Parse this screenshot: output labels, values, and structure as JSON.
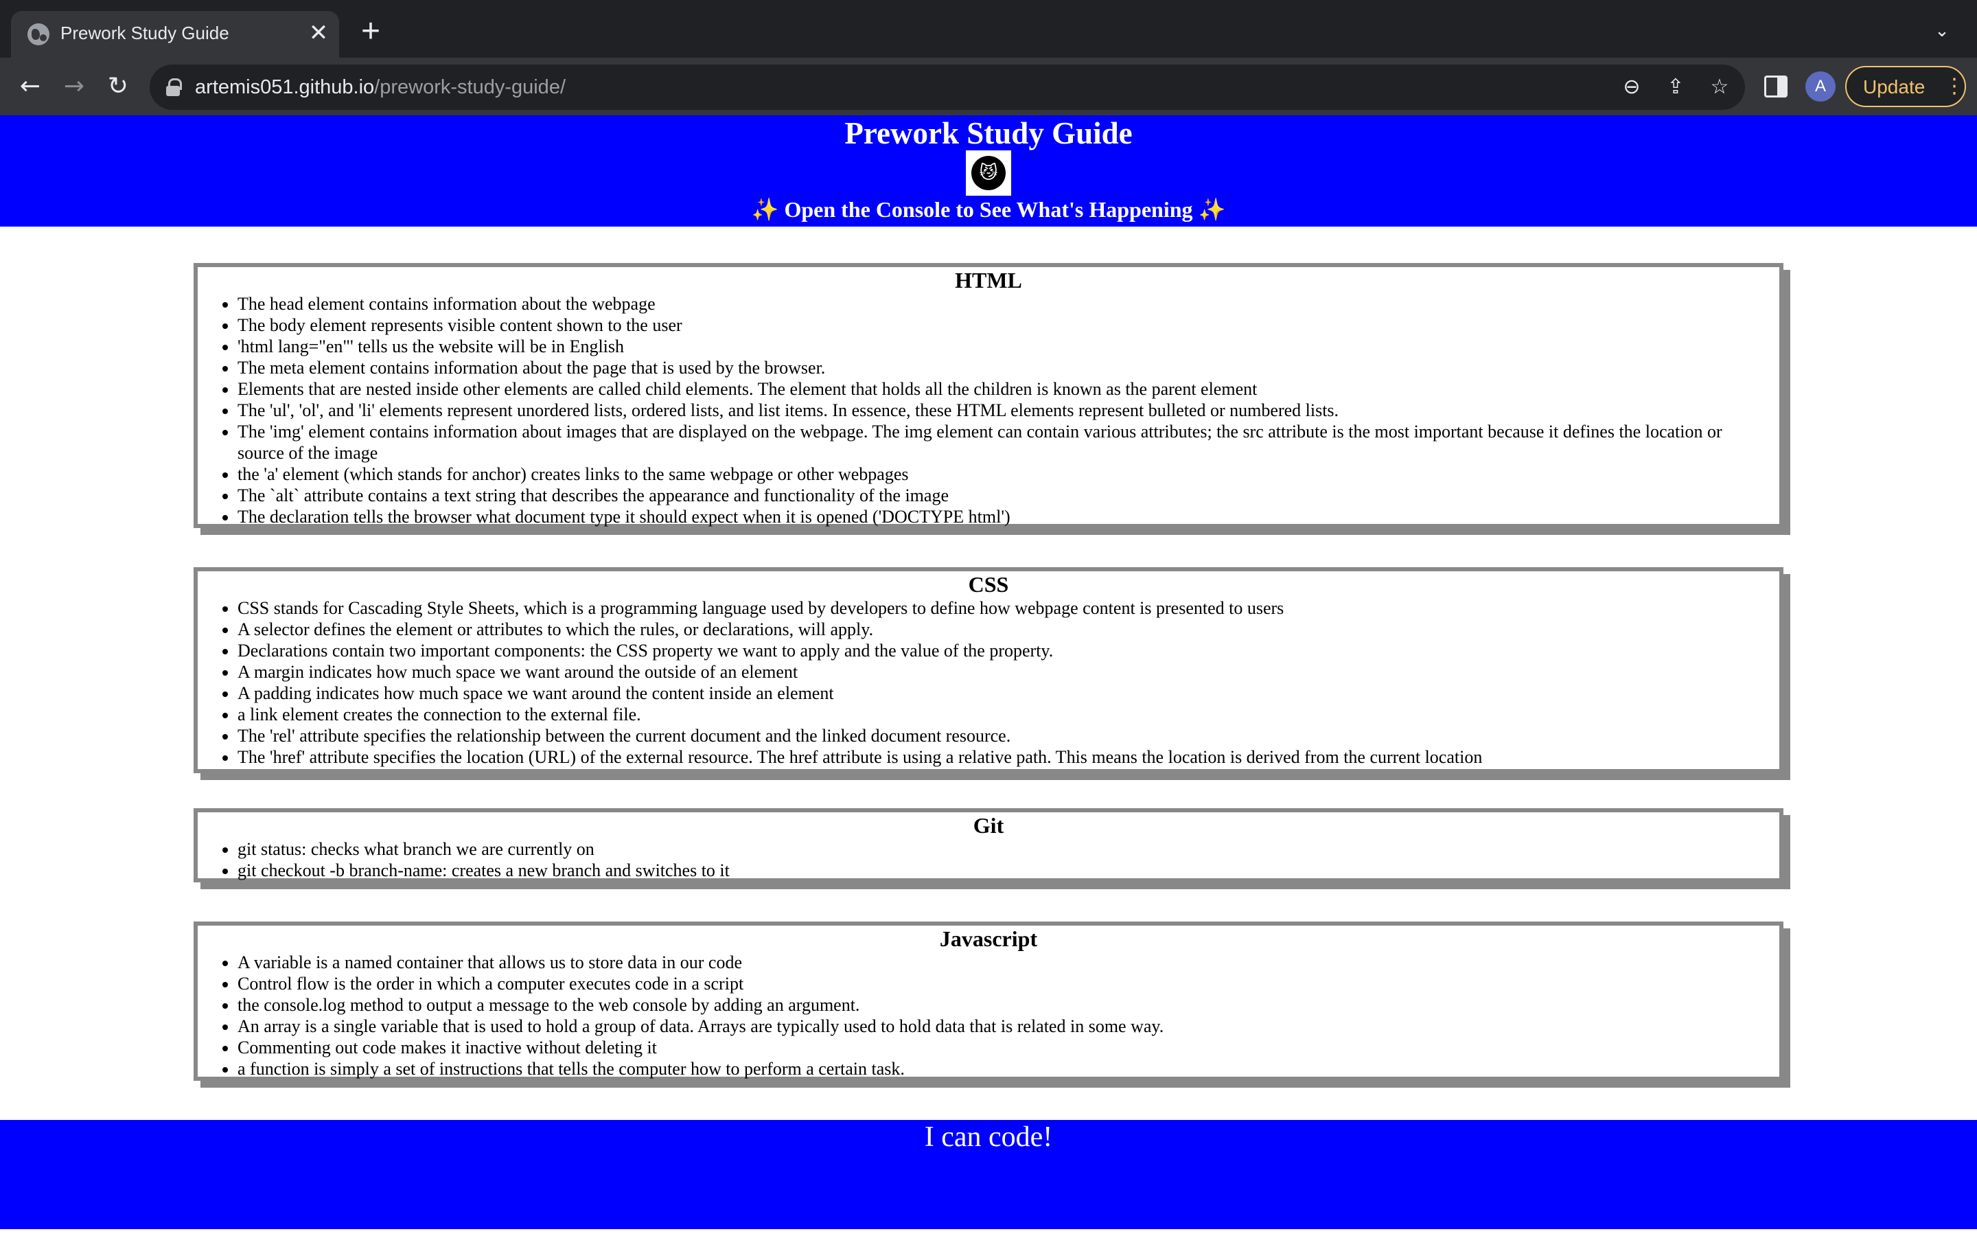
{
  "browser": {
    "tab_title": "Prework Study Guide",
    "tab_close": "✕",
    "new_tab": "+",
    "tab_search": "⌄",
    "back": "←",
    "forward": "→",
    "reload": "↻",
    "url_host": "artemis051.github.io",
    "url_path": "/prework-study-guide/",
    "zoom_icon": "⊖",
    "share_icon": "⇪",
    "bookmark_icon": "☆",
    "avatar_letter": "A",
    "update_label": "Update",
    "menu_dots": "⋮"
  },
  "header": {
    "title": "Prework Study Guide",
    "logo_icon": "cat-icon",
    "subtitle": "✨ Open the Console to See What's Happening ✨"
  },
  "sections": {
    "html": {
      "title": "HTML",
      "items": [
        "The head element contains information about the webpage",
        "The body element represents visible content shown to the user",
        "'html lang=\"en\"' tells us the website will be in English",
        "The meta element contains information about the page that is used by the browser.",
        "Elements that are nested inside other elements are called child elements. The element that holds all the children is known as the parent element",
        "The 'ul', 'ol', and 'li' elements represent unordered lists, ordered lists, and list items. In essence, these HTML elements represent bulleted or numbered lists.",
        "The 'img' element contains information about images that are displayed on the webpage. The img element can contain various attributes; the src attribute is the most important because it defines the location or source of the image",
        "the 'a' element (which stands for anchor) creates links to the same webpage or other webpages",
        "The `alt` attribute contains a text string that describes the appearance and functionality of the image",
        "The declaration tells the browser what document type it should expect when it is opened ('DOCTYPE html')"
      ]
    },
    "css": {
      "title": "CSS",
      "items": [
        "CSS stands for Cascading Style Sheets, which is a programming language used by developers to define how webpage content is presented to users",
        "A selector defines the element or attributes to which the rules, or declarations, will apply.",
        "Declarations contain two important components: the CSS property we want to apply and the value of the property.",
        "A margin indicates how much space we want around the outside of an element",
        "A padding indicates how much space we want around the content inside an element",
        "a link element creates the connection to the external file.",
        "The 'rel' attribute specifies the relationship between the current document and the linked document resource.",
        "The 'href' attribute specifies the location (URL) of the external resource. The href attribute is using a relative path. This means the location is derived from the current location"
      ]
    },
    "git": {
      "title": "Git",
      "items": [
        "git status: checks what branch we are currently on",
        "git checkout -b branch-name: creates a new branch and switches to it"
      ]
    },
    "javascript": {
      "title": "Javascript",
      "items": [
        "A variable is a named container that allows us to store data in our code",
        "Control flow is the order in which a computer executes code in a script",
        "the console.log method to output a message to the web console by adding an argument.",
        "An array is a single variable that is used to hold a group of data. Arrays are typically used to hold data that is related in some way.",
        "Commenting out code makes it inactive without deleting it",
        "a function is simply a set of instructions that tells the computer how to perform a certain task."
      ]
    }
  },
  "footer": {
    "text": "I can code!"
  },
  "colors": {
    "header_bg": "#0000ff",
    "footer_bg": "#0000ff",
    "card_border": "#888888",
    "chrome_bg": "#202124",
    "update_accent": "#f0c36a"
  }
}
